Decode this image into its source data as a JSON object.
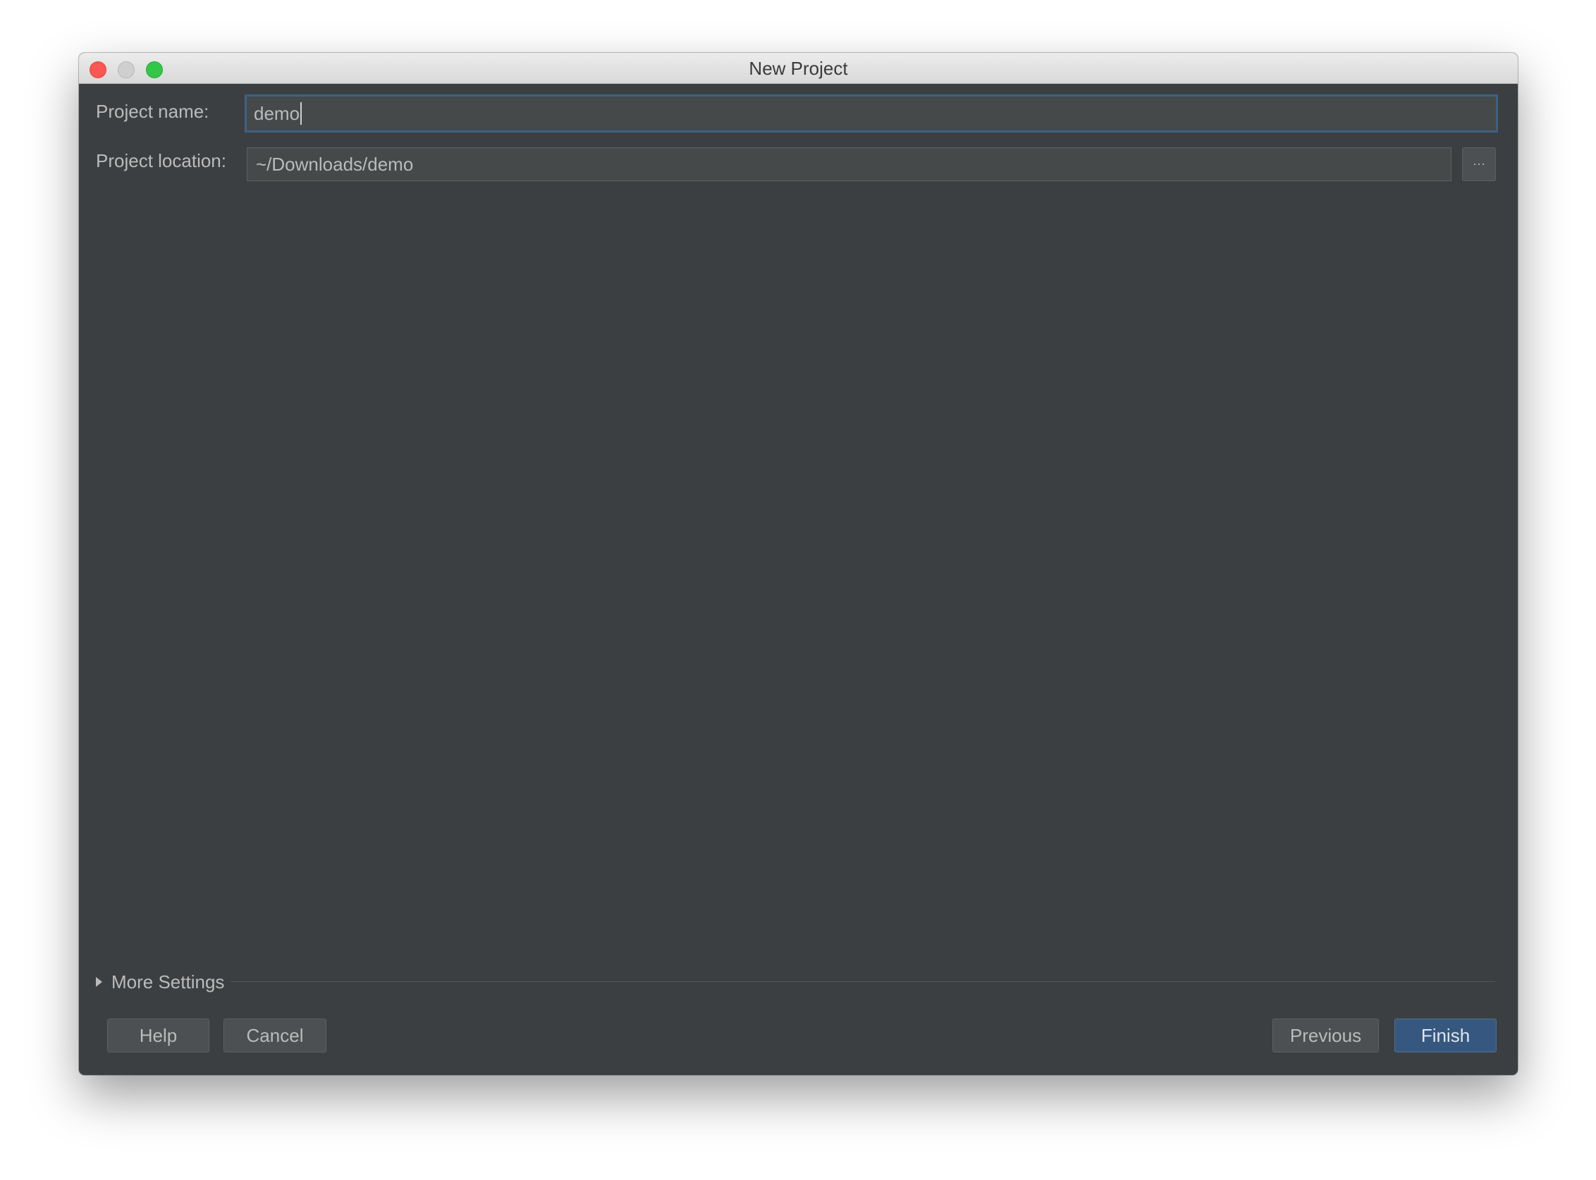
{
  "window": {
    "title": "New Project"
  },
  "form": {
    "project_name_label": "Project name:",
    "project_name_value": "demo",
    "project_location_label": "Project location:",
    "project_location_value": "~/Downloads/demo",
    "browse_label": "···"
  },
  "more_settings": {
    "label": "More Settings",
    "expanded": false
  },
  "footer": {
    "help_label": "Help",
    "cancel_label": "Cancel",
    "previous_label": "Previous",
    "finish_label": "Finish"
  },
  "colors": {
    "background": "#3c3f41",
    "field": "#45494a",
    "focus_border": "#3d6185",
    "primary_button": "#365880",
    "text": "#bbbbbb"
  }
}
